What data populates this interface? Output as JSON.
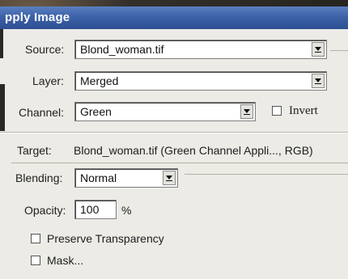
{
  "window": {
    "title": "pply Image"
  },
  "source": {
    "label": "Source:",
    "value": "Blond_woman.tif"
  },
  "layer": {
    "label": "Layer:",
    "value": "Merged"
  },
  "channel": {
    "label": "Channel:",
    "value": "Green",
    "invert_label": "Invert"
  },
  "target": {
    "label": "Target:",
    "value": "Blond_woman.tif (Green Channel Appli..., RGB)"
  },
  "blending": {
    "label": "Blending:",
    "value": "Normal",
    "opacity_label": "Opacity:",
    "opacity_value": "100",
    "opacity_unit": "%",
    "preserve_transparency_label": "Preserve Transparency",
    "mask_label": "Mask..."
  }
}
